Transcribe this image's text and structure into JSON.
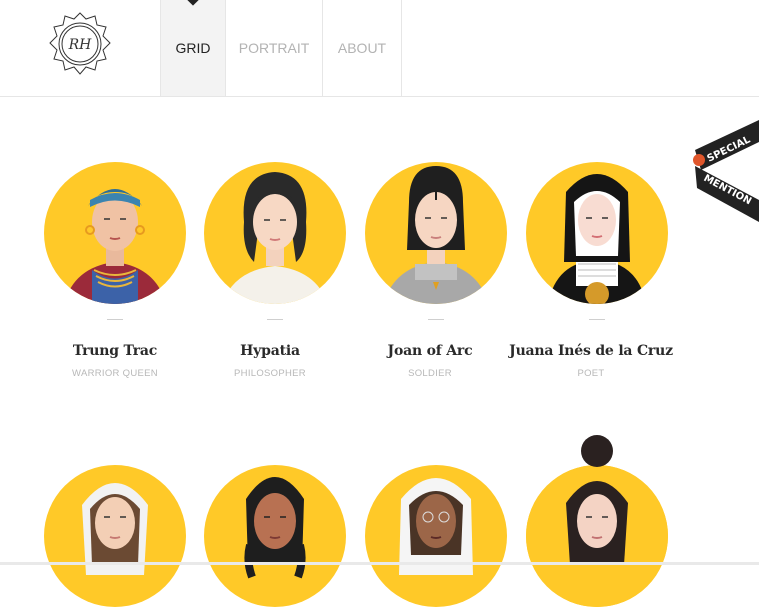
{
  "header": {
    "logo_initials": "RH",
    "nav": [
      {
        "label": "GRID",
        "active": true
      },
      {
        "label": "PORTRAIT",
        "active": false
      },
      {
        "label": "ABOUT",
        "active": false
      }
    ]
  },
  "badge": {
    "line1": "SPECIAL",
    "line2": "MENTION"
  },
  "cards": [
    {
      "name": "Trung Trac",
      "role": "WARRIOR QUEEN"
    },
    {
      "name": "Hypatia",
      "role": "PHILOSOPHER"
    },
    {
      "name": "Joan of Arc",
      "role": "SOLDIER"
    },
    {
      "name": "Juana Inés de la Cruz",
      "role": "POET"
    }
  ],
  "colors": {
    "accent": "#ffc928",
    "text": "#2a2a2a",
    "muted": "#b8b8b8"
  }
}
